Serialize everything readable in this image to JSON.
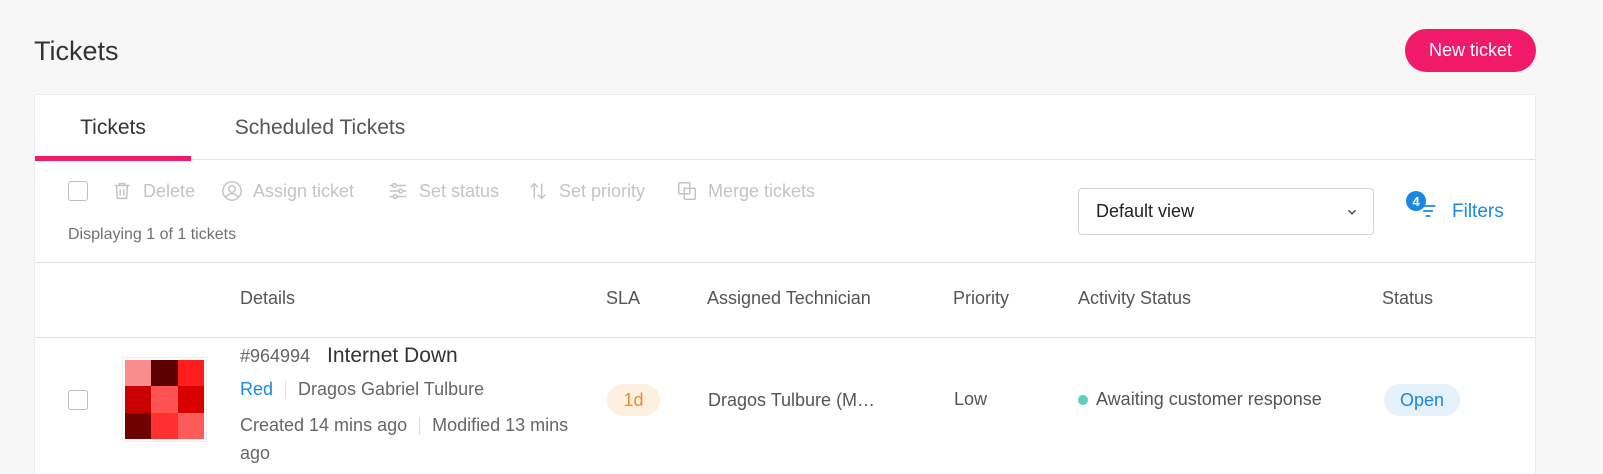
{
  "header": {
    "title": "Tickets",
    "new_ticket_label": "New ticket",
    "accent_color": "#f0196a"
  },
  "tabs": [
    {
      "label": "Tickets",
      "active": true
    },
    {
      "label": "Scheduled Tickets",
      "active": false
    }
  ],
  "toolbar": {
    "actions": [
      {
        "label": "Delete",
        "icon": "trash-icon"
      },
      {
        "label": "Assign ticket",
        "icon": "user-circle-icon"
      },
      {
        "label": "Set status",
        "icon": "sliders-icon"
      },
      {
        "label": "Set priority",
        "icon": "sort-arrows-icon"
      },
      {
        "label": "Merge tickets",
        "icon": "merge-icon"
      }
    ],
    "displaying_text": "Displaying 1 of 1 tickets",
    "view_select": "Default view",
    "filters_label": "Filters",
    "filters_count": "4"
  },
  "table": {
    "columns": [
      "Details",
      "SLA",
      "Assigned Technician",
      "Priority",
      "Activity Status",
      "Status"
    ],
    "rows": [
      {
        "number": "#964994",
        "title": "Internet Down",
        "customer": "Red",
        "contact": "Dragos Gabriel Tulbure",
        "created": "Created 14 mins ago",
        "modified": "Modified 13 mins ago",
        "sla": "1d",
        "technician": "Dragos Tulbure (M…",
        "priority": "Low",
        "activity_status": "Awaiting customer response",
        "status": "Open"
      }
    ]
  },
  "colors": {
    "link_blue": "#1a88e0",
    "sla_orange": "#e89023",
    "activity_dot": "#5ccfbf"
  }
}
